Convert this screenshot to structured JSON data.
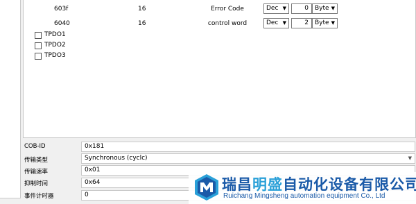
{
  "mapping_rows": [
    {
      "index": "603f",
      "bits": "16",
      "name": "Error Code",
      "format": "Dec",
      "value": "0",
      "unit": "Byte"
    },
    {
      "index": "6040",
      "bits": "16",
      "name": "control word",
      "format": "Dec",
      "value": "2",
      "unit": "Byte"
    }
  ],
  "tpdo_list": [
    "TPDO1",
    "TPDO2",
    "TPDO3"
  ],
  "properties": {
    "cob_id": {
      "label": "COB-ID",
      "value": "0x181"
    },
    "transmission_type": {
      "label": "传输类型",
      "value": "Synchronous (cyclc)"
    },
    "transmission_rate": {
      "label": "传输速率",
      "value": "0x01"
    },
    "inhibit_time": {
      "label": "抑制时间",
      "value": "0x64"
    },
    "event_timer": {
      "label": "事件计时器",
      "value": "0"
    }
  },
  "watermark": {
    "company_part1": "瑞昌",
    "company_part2": "明盛",
    "company_part3": "自动化设备有限公司",
    "subtitle": "Ruichang Mingsheng automation equipment Co., Ltd"
  },
  "colors": {
    "brand_dark": "#1a5aa8",
    "brand_light": "#2aa0d8"
  }
}
